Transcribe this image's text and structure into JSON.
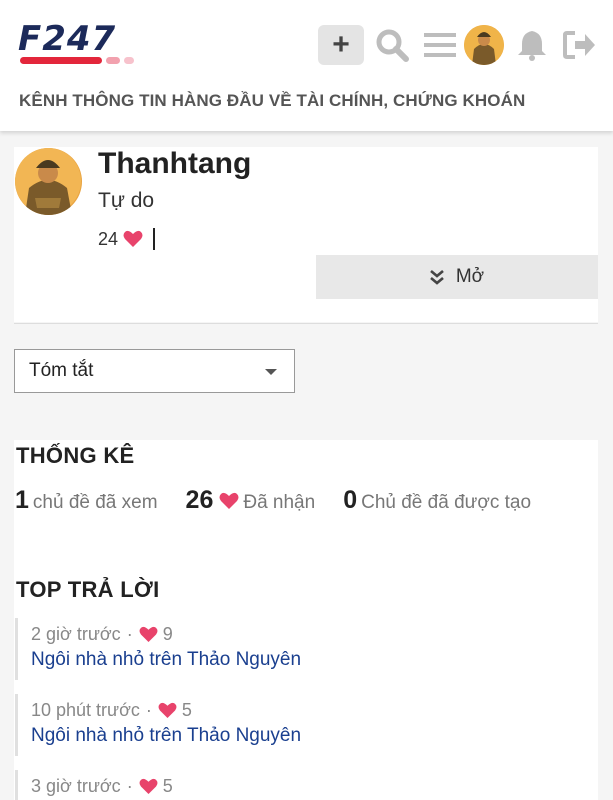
{
  "header": {
    "logo_text": "F247",
    "tagline": "KÊNH THÔNG TIN HÀNG ĐẦU VỀ TÀI CHÍNH, CHỨNG KHOÁN",
    "plus_label": "+",
    "icons": [
      "search-icon",
      "menu-icon",
      "avatar",
      "bell-icon",
      "logout-icon"
    ]
  },
  "profile": {
    "username": "Thanhtang",
    "title": "Tự do",
    "likes": "24",
    "expand_label": "Mở"
  },
  "filter": {
    "selected": "Tóm tắt"
  },
  "stats": {
    "title": "THỐNG KÊ",
    "topics_viewed_value": "1",
    "topics_viewed_label": "chủ đề đã xem",
    "likes_received_value": "26",
    "likes_received_label": "Đã nhận",
    "topics_created_value": "0",
    "topics_created_label": "Chủ đề đã được tạo"
  },
  "top_replies": {
    "title": "TOP TRẢ LỜI",
    "items": [
      {
        "time": "2 giờ trước",
        "likes": "9",
        "topic": "Ngôi nhà nhỏ trên Thảo Nguyên"
      },
      {
        "time": "10 phút trước",
        "likes": "5",
        "topic": "Ngôi nhà nhỏ trên Thảo Nguyên"
      },
      {
        "time": "3 giờ trước",
        "likes": "5",
        "topic": ""
      }
    ]
  },
  "colors": {
    "brand_navy": "#1c2a5a",
    "brand_red": "#e3263b",
    "heart": "#e8436b",
    "link": "#1a3f8f"
  }
}
